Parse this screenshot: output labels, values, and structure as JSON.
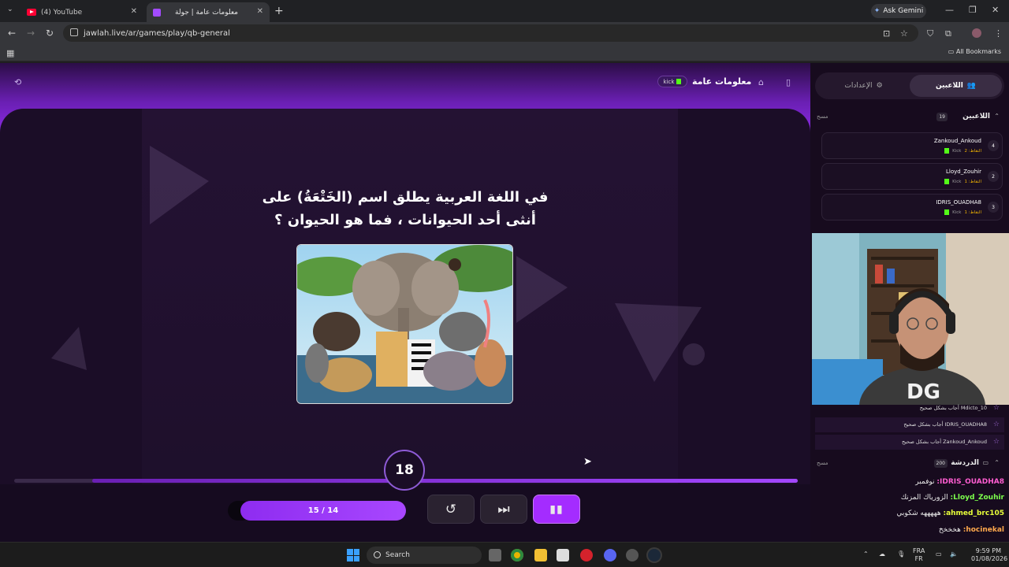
{
  "browser": {
    "tabs": [
      {
        "title": "(4) YouTube"
      },
      {
        "title": "معلومات عامة | جولة"
      }
    ],
    "url": "jawlah.live/ar/games/play/qb-general",
    "ask_gemini": "Ask Gemini",
    "all_bookmarks": "All Bookmarks"
  },
  "game": {
    "title": "معلومات عامة",
    "platform": "kick",
    "question_line1": "في اللغة العربية يطلق اسم (الخَتْعَةُ) على",
    "question_line2": "أنثى أحد الحيوانات ، فما هو الحيوان ؟",
    "timer": "18",
    "question_counter": "15 / 14",
    "progress_fraction": 0.9
  },
  "sidebar": {
    "tab_players": "اللاعبين",
    "tab_settings": "الإعدادات",
    "players_section": {
      "label": "اللاعبين",
      "count": "19",
      "clear": "مسح"
    },
    "players": [
      {
        "name": "Zankoud_Ankoud",
        "points": "النقاط: 2",
        "platform": "Kick",
        "rank": "4"
      },
      {
        "name": "Lloyd_Zouhir",
        "points": "النقاط: 1",
        "platform": "Kick",
        "rank": "2"
      },
      {
        "name": "IDRIS_OUADHA8",
        "points": "النقاط: 1",
        "platform": "Kick",
        "rank": "3"
      }
    ],
    "feed": [
      {
        "text": "Mdicto_10 أجاب بشكل صحيح"
      },
      {
        "text": "IDRIS_OUADHA8 أجاب بشكل صحيح"
      },
      {
        "text": "Zankoud_Ankoud أجاب بشكل صحيح"
      }
    ],
    "chat_section": {
      "label": "الدردشة",
      "count": "200",
      "clear": "مسح"
    },
    "chat": [
      {
        "user": "IDRIS_OUADHA8:",
        "msg": "نوفمبر",
        "color": "#ff5dd1"
      },
      {
        "user": "Lloyd_Zouhir:",
        "msg": "الزورياك المزنك",
        "color": "#7dff4d"
      },
      {
        "user": "ahmed_brc105:",
        "msg": "هههههه شكوبي",
        "color": "#e8ff3a"
      },
      {
        "user": "hocinekal:",
        "msg": "هخخخخ",
        "color": "#ffa94d"
      }
    ]
  },
  "taskbar": {
    "search": "Search",
    "lang_top": "FRA",
    "lang_bottom": "FR",
    "time": "9:59 PM",
    "date": "01/08/2026"
  },
  "colors": {
    "accent": "#a42cff",
    "kick_green": "#53fc18"
  }
}
